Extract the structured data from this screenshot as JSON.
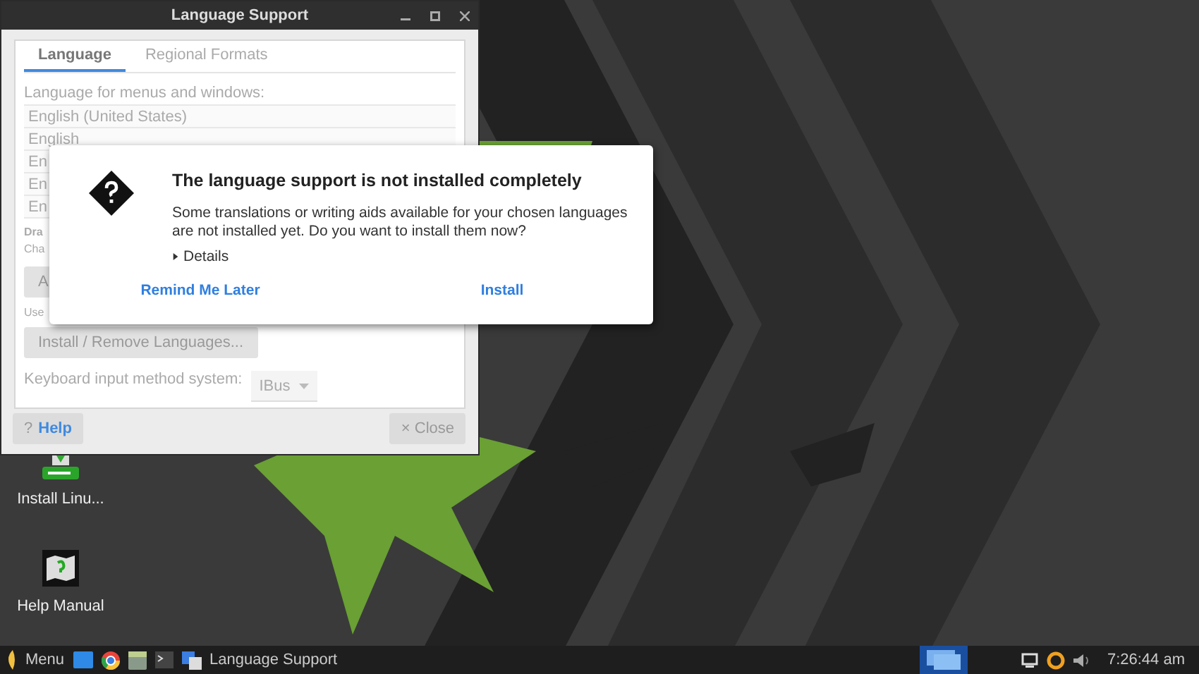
{
  "window": {
    "title": "Language Support",
    "tabs": [
      {
        "label": "Language",
        "selected": true
      },
      {
        "label": "Regional Formats",
        "selected": false
      }
    ],
    "list_label": "Language for menus and windows:",
    "languages": [
      "English (United States)",
      "English",
      "En",
      "En",
      "En"
    ],
    "drag_hint": "Dra",
    "change_hint": "Cha",
    "apply_button": "A",
    "use_hint": "Use",
    "install_button": "Install / Remove Languages...",
    "input_method_label": "Keyboard input method system:",
    "input_method": "IBus",
    "help_button": {
      "mark": "?",
      "label": "Help"
    },
    "close_button": {
      "mark": "×",
      "label": "Close"
    }
  },
  "dialog": {
    "title": "The language support is not installed completely",
    "message": "Some translations or writing aids available for your chosen languages are not installed yet. Do you want to install them now?",
    "details": {
      "label": "Details",
      "expanded": false
    },
    "buttons": [
      "Remind Me Later",
      "Install"
    ]
  },
  "desktop_icons": [
    {
      "kind": "installer",
      "label": "Install Linu..."
    },
    {
      "kind": "manual",
      "label": "Help Manual"
    }
  ],
  "taskbar": {
    "menu": "Menu",
    "task": "Language Support",
    "clock": "7:26:44 am"
  }
}
